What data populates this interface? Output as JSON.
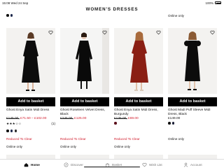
{
  "status_bar": {
    "time": "15:08",
    "date": "Wed 24 Sep",
    "battery": "100%"
  },
  "header": {
    "title": "WOMEN'S DRESSES"
  },
  "top_row": [
    {
      "text": "£108.00"
    },
    {
      "text": ""
    },
    {
      "text": ""
    },
    {
      "text": "Online only"
    }
  ],
  "products": [
    {
      "name": "Ghost Enya Satin Midi Dress",
      "price_was": "£145.00,",
      "price_now": "£71.50 – £102.00",
      "stars": "★★★☆☆",
      "rating_count": "(1)",
      "swatches": [
        "#111111",
        "#1f2a4d",
        "#2c2c2c"
      ],
      "reduced": "Reduced To Clear",
      "online": "Online only",
      "basket_label": "Add to basket"
    },
    {
      "name": "Ghost Roseleen Velvet Dress, Black",
      "price_was": "£245.00,",
      "price_now": "£125.00",
      "stars": "",
      "rating_count": "",
      "swatches": [],
      "reduced": "Reduced To Clear",
      "online": "Online only",
      "basket_label": "Add to basket"
    },
    {
      "name": "Ghost Enya Satin Midi Dress, Burgundy",
      "price_was": "£135.00,",
      "price_now": "£69.00",
      "stars": "",
      "rating_count": "",
      "swatches": [
        "#5a0d1a"
      ],
      "reduced": "Reduced To Clear",
      "online": "Online only",
      "basket_label": "Add to basket"
    },
    {
      "name": "Ghost Madi Puff Sleeve Midi Dress, Black",
      "price_was": "",
      "price_now": "£149.00",
      "stars": "",
      "rating_count": "",
      "swatches": [
        "#111111",
        "#1d2138"
      ],
      "reduced": "",
      "online": "Online only",
      "basket_label": "Add to basket"
    }
  ],
  "tabbar": {
    "items": [
      {
        "label": "Home",
        "icon": "home-icon",
        "active": true
      },
      {
        "label": "Discover",
        "icon": "discover-icon",
        "active": false
      },
      {
        "label": "Basket",
        "icon": "basket-icon",
        "active": false
      },
      {
        "label": "Wish List",
        "icon": "heart-icon",
        "active": false
      },
      {
        "label": "Account",
        "icon": "person-icon",
        "active": false
      }
    ]
  },
  "colors": {
    "sale_red": "#d11a2a",
    "button_black": "#000000"
  }
}
